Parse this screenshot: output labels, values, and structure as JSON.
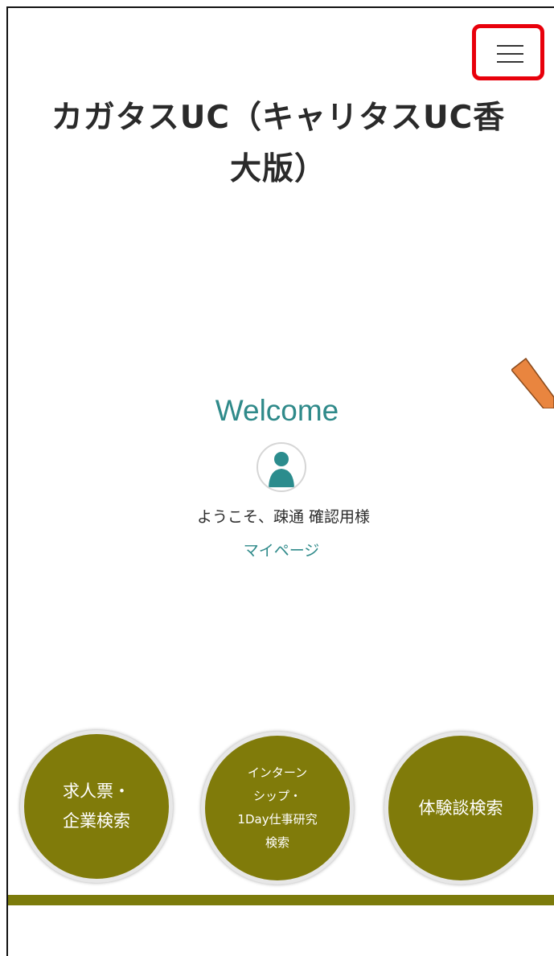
{
  "header": {
    "menu_icon": "hamburger-menu-icon",
    "highlight_color": "#e8000b"
  },
  "page": {
    "title_line1": "カガタスUC（キャリタスUC香",
    "title_line2": "大版）"
  },
  "welcome": {
    "heading": "Welcome",
    "avatar_icon": "user-avatar-icon",
    "greeting": "ようこそ、疎通 確認用様",
    "mypage_link": "マイページ",
    "accent_color": "#2f8a8a"
  },
  "nav_circles": [
    {
      "lines": [
        "求人票・",
        "企業検索"
      ]
    },
    {
      "lines": [
        "インターン",
        "シップ・",
        "1Day仕事研究",
        "検索"
      ]
    },
    {
      "lines": [
        "体験談検索"
      ]
    }
  ],
  "colors": {
    "circle_fill": "#807b0a",
    "annotation_arrow": "#e9853f"
  }
}
